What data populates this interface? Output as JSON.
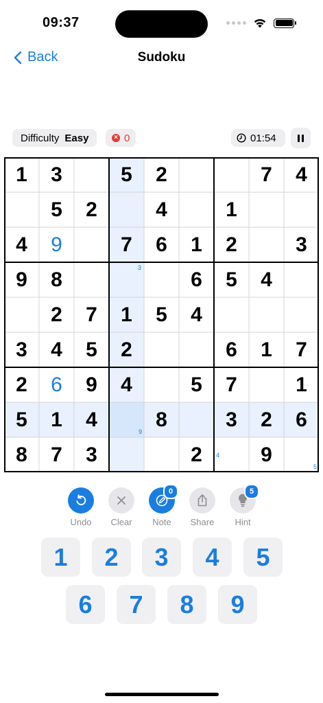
{
  "status": {
    "time": "09:37"
  },
  "nav": {
    "back_label": "Back",
    "title": "Sudoku"
  },
  "info": {
    "difficulty_label": "Difficulty",
    "difficulty_value": "Easy",
    "mistakes": "0",
    "timer": "01:54"
  },
  "board": {
    "rows": [
      [
        "1",
        "3",
        "",
        "5",
        "2",
        "",
        "",
        "7",
        "4"
      ],
      [
        "",
        "5",
        "2",
        "",
        "4",
        "",
        "1",
        "",
        ""
      ],
      [
        "4",
        "9",
        "",
        "7",
        "6",
        "1",
        "2",
        "",
        "3"
      ],
      [
        "9",
        "8",
        "",
        "",
        "",
        "6",
        "5",
        "4",
        ""
      ],
      [
        "",
        "2",
        "7",
        "1",
        "5",
        "4",
        "",
        "",
        ""
      ],
      [
        "3",
        "4",
        "5",
        "2",
        "",
        "",
        "6",
        "1",
        "7"
      ],
      [
        "2",
        "6",
        "9",
        "4",
        "",
        "5",
        "7",
        "",
        "1"
      ],
      [
        "5",
        "1",
        "4",
        "",
        "8",
        "",
        "3",
        "2",
        "6"
      ],
      [
        "8",
        "7",
        "3",
        "",
        "",
        "2",
        "",
        "9",
        ""
      ]
    ],
    "user_cells": [
      "2-1",
      "6-1"
    ],
    "notes": {
      "3-3": "3",
      "7-3": "9",
      "8-6": "4",
      "8-8": "5"
    },
    "selected": {
      "row": 7,
      "col": 3
    }
  },
  "toolbar": {
    "undo": "Undo",
    "clear": "Clear",
    "note": "Note",
    "note_badge": "0",
    "share": "Share",
    "hint": "Hint",
    "hint_badge": "5"
  },
  "numpad": [
    "1",
    "2",
    "3",
    "4",
    "5",
    "6",
    "7",
    "8",
    "9"
  ],
  "colors": {
    "accent": "#1a7de0",
    "highlight": "#e8f1fd",
    "error": "#e53935"
  }
}
